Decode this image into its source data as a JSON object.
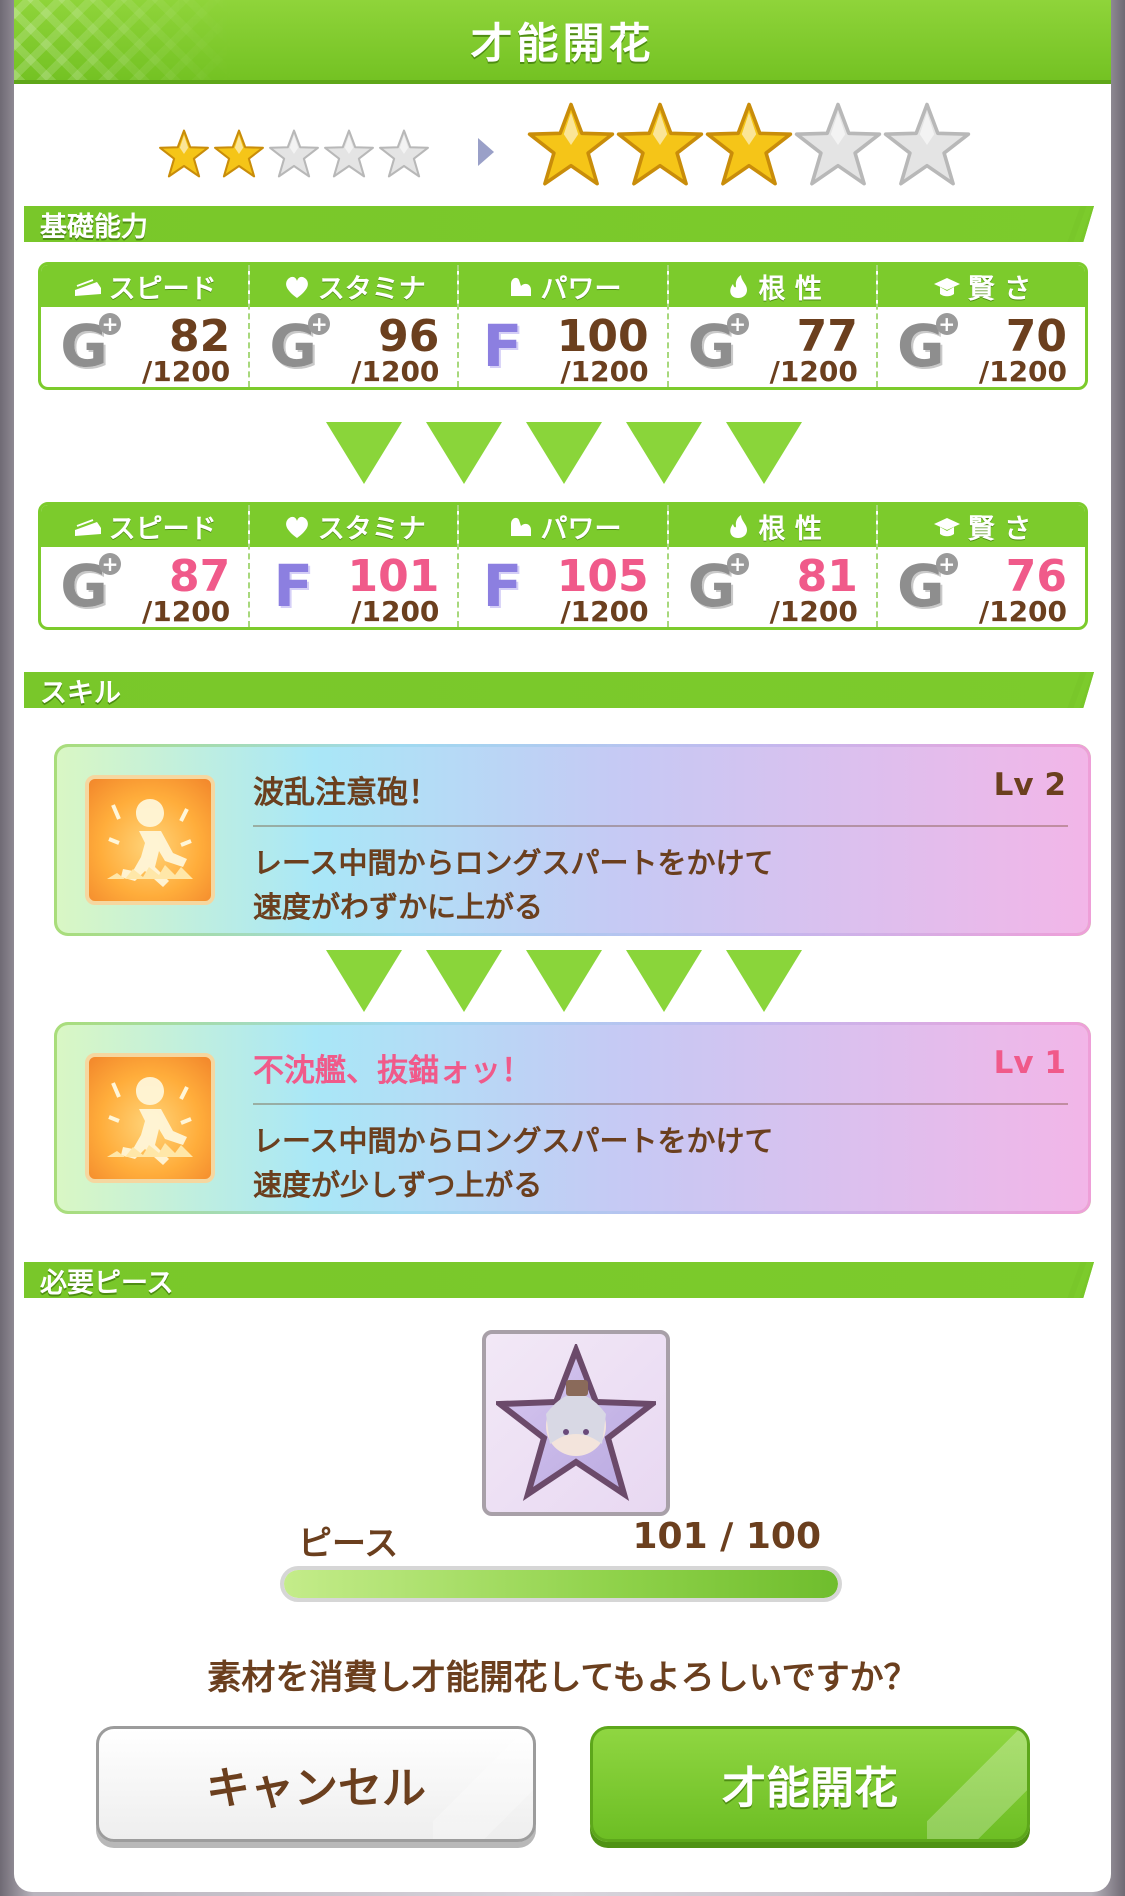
{
  "dialog": {
    "title": "才能開花"
  },
  "rarity": {
    "current_stars": 2,
    "next_stars": 3,
    "max_stars": 5,
    "star_color": "#f5c518",
    "empty_star_color": "#e4e4e4"
  },
  "sections": {
    "base_stats": "基礎能力",
    "skill": "スキル",
    "required_pieces": "必要ピース"
  },
  "stats_before": [
    {
      "label": "スピード",
      "icon": "shoe-icon",
      "grade": "G",
      "plus": "+",
      "value": "82",
      "max": "/1200"
    },
    {
      "label": "スタミナ",
      "icon": "heart-icon",
      "grade": "G",
      "plus": "+",
      "value": "96",
      "max": "/1200"
    },
    {
      "label": "パワー",
      "icon": "arm-icon",
      "grade": "F",
      "plus": "",
      "value": "100",
      "max": "/1200"
    },
    {
      "label": "根 性",
      "icon": "flame-icon",
      "grade": "G",
      "plus": "+",
      "value": "77",
      "max": "/1200"
    },
    {
      "label": "賢 さ",
      "icon": "graduation-cap-icon",
      "grade": "G",
      "plus": "+",
      "value": "70",
      "max": "/1200"
    }
  ],
  "stats_after": [
    {
      "label": "スピード",
      "icon": "shoe-icon",
      "grade": "G",
      "plus": "+",
      "value": "87",
      "max": "/1200"
    },
    {
      "label": "スタミナ",
      "icon": "heart-icon",
      "grade": "F",
      "plus": "",
      "value": "101",
      "max": "/1200"
    },
    {
      "label": "パワー",
      "icon": "arm-icon",
      "grade": "F",
      "plus": "",
      "value": "105",
      "max": "/1200"
    },
    {
      "label": "根 性",
      "icon": "flame-icon",
      "grade": "G",
      "plus": "+",
      "value": "81",
      "max": "/1200"
    },
    {
      "label": "賢 さ",
      "icon": "graduation-cap-icon",
      "grade": "G",
      "plus": "+",
      "value": "76",
      "max": "/1200"
    }
  ],
  "skill_before": {
    "name": "波乱注意砲！",
    "level": "Lv 2",
    "desc_line1": "レース中間からロングスパートをかけて",
    "desc_line2": "速度がわずかに上がる",
    "icon": "running-horse-speed-icon"
  },
  "skill_after": {
    "name": "不沈艦、抜錨ォッ！",
    "level": "Lv 1",
    "desc_line1": "レース中間からロングスパートをかけて",
    "desc_line2": "速度が少しずつ上がる",
    "icon": "running-horse-speed-icon"
  },
  "piece": {
    "label": "ピース",
    "count": "101 / 100",
    "progress": 1.0,
    "icon": "character-piece-icon"
  },
  "confirm_text": "素材を消費し才能開花してもよろしいですか？",
  "buttons": {
    "cancel": "キャンセル",
    "confirm": "才能開花"
  },
  "colors": {
    "accent": "#7ccb2c",
    "increase": "#f05a8a",
    "text": "#6b3f1e"
  }
}
